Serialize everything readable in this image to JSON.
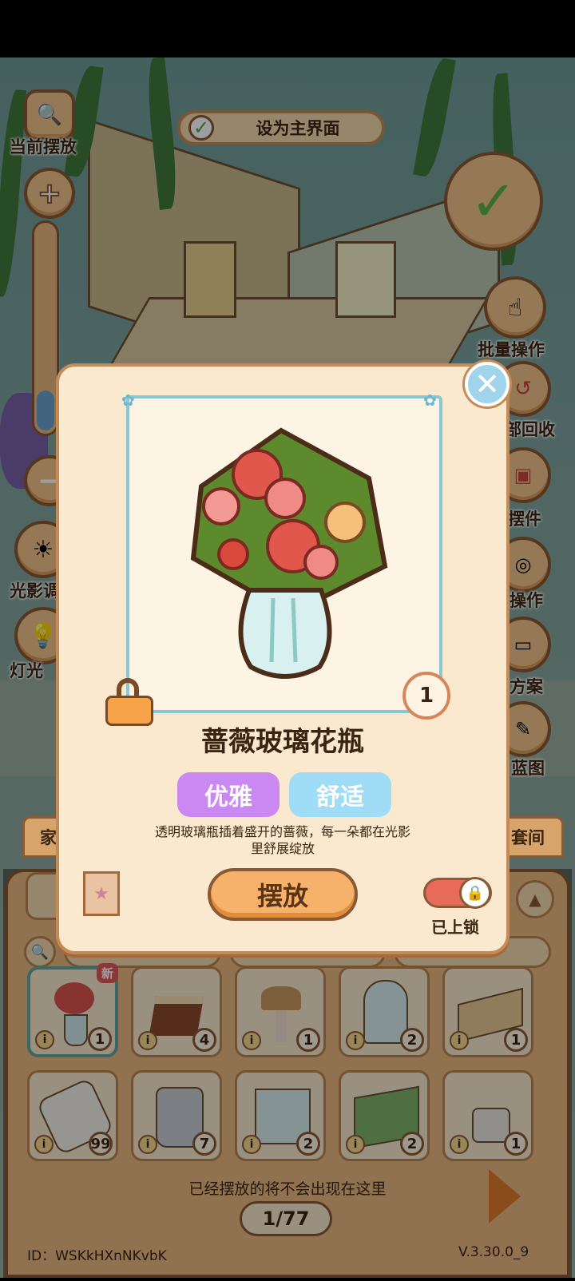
{
  "top": {
    "current_layout_label": "当前摆放",
    "set_main_label": "设为主界面"
  },
  "left_tools": {
    "lighting_label": "光影调",
    "lamp_label": "灯光"
  },
  "right_tools": {
    "batch_label": "批量操作",
    "recycle_label": "部回收",
    "place_parts_label": "摆件",
    "operate_label": "操作",
    "scheme_label": "方案",
    "blueprint_label": "蓝图",
    "suite_label": "套间"
  },
  "panel": {
    "furniture_tab": "家具",
    "hint": "已经摆放的将不会出现在这里",
    "page": "1/77",
    "id_text": "ID：WSKkHXnNKvbK",
    "version": "V.3.30.0_9",
    "new_badge": "新",
    "items": [
      {
        "name": "rose-vase",
        "qty": "1",
        "selected": true,
        "new": true
      },
      {
        "name": "cake",
        "qty": "4"
      },
      {
        "name": "lamp",
        "qty": "1"
      },
      {
        "name": "glass-dome",
        "qty": "2"
      },
      {
        "name": "tissue-box",
        "qty": "1"
      },
      {
        "name": "pillow",
        "qty": "99"
      },
      {
        "name": "plastic-bag",
        "qty": "7"
      },
      {
        "name": "glass-box",
        "qty": "2"
      },
      {
        "name": "butterfly-terrarium",
        "qty": "2"
      },
      {
        "name": "heater",
        "qty": "1"
      }
    ]
  },
  "modal": {
    "item_name": "蔷薇玻璃花瓶",
    "count": "1",
    "tags": [
      "优雅",
      "舒适"
    ],
    "description_line1": "透明玻璃瓶插着盛开的蔷薇，每一朵都在光影",
    "description_line2": "里舒展绽放",
    "place_button": "摆放",
    "locked_label": "已上锁",
    "colors": {
      "tag_elegant": "#c988f2",
      "tag_comfort": "#9fdcf5",
      "frame": "#86c9d3",
      "button": "#f6b26b"
    }
  }
}
